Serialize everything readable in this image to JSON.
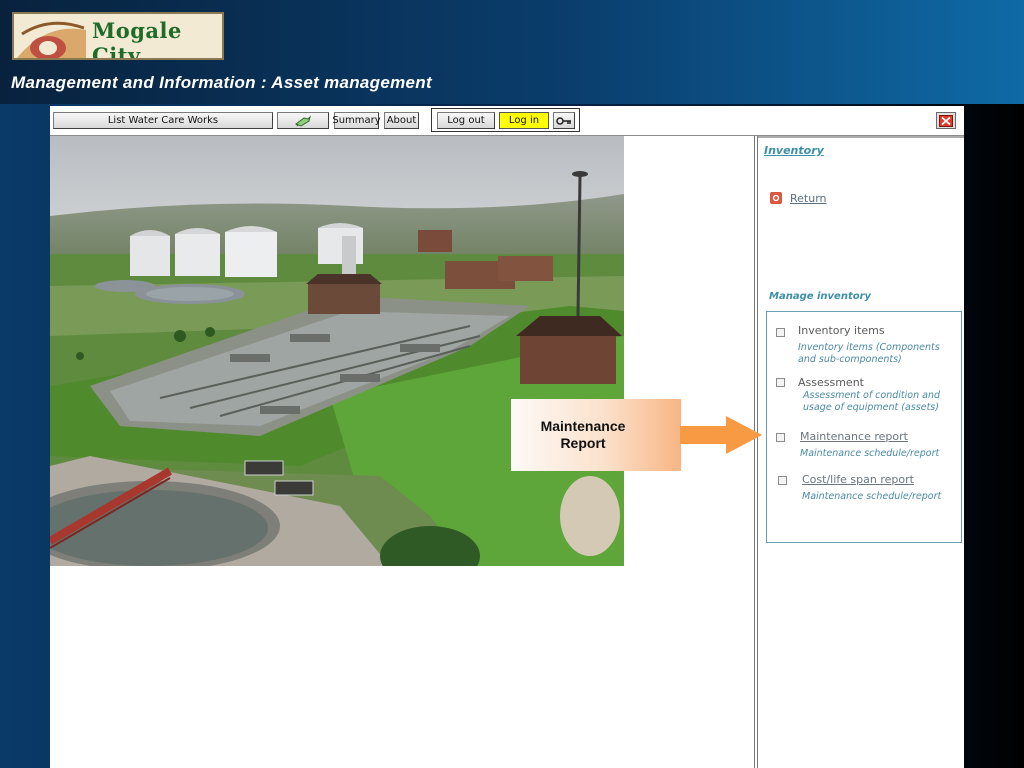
{
  "header": {
    "logo_text": "Mogale City",
    "page_title": "Management and Information : Asset management"
  },
  "toolbar": {
    "list_water_care_works": "List Water Care Works",
    "summary": "Summary",
    "about": "About",
    "log_out": "Log out",
    "log_in": "Log in"
  },
  "sidebar": {
    "heading": "Inventory",
    "return_label": "Return",
    "manage_heading": "Manage inventory",
    "items": [
      {
        "title": "Inventory items",
        "description": "Inventory items (Components and sub-components)"
      },
      {
        "title": "Assessment",
        "description": "Assessment of condition and usage of equipment (assets)"
      },
      {
        "title": "Maintenance report",
        "description": "Maintenance schedule/report"
      },
      {
        "title": "Cost/life span report",
        "description": "Maintenance schedule/report"
      }
    ]
  },
  "callout": {
    "line1": "Maintenance",
    "line2": "Report"
  },
  "colors": {
    "login_highlight": "#ffff00",
    "accent_teal": "#3c8fa8",
    "callout_arrow": "#f79a43",
    "header_blue": "#0a3d6c"
  }
}
